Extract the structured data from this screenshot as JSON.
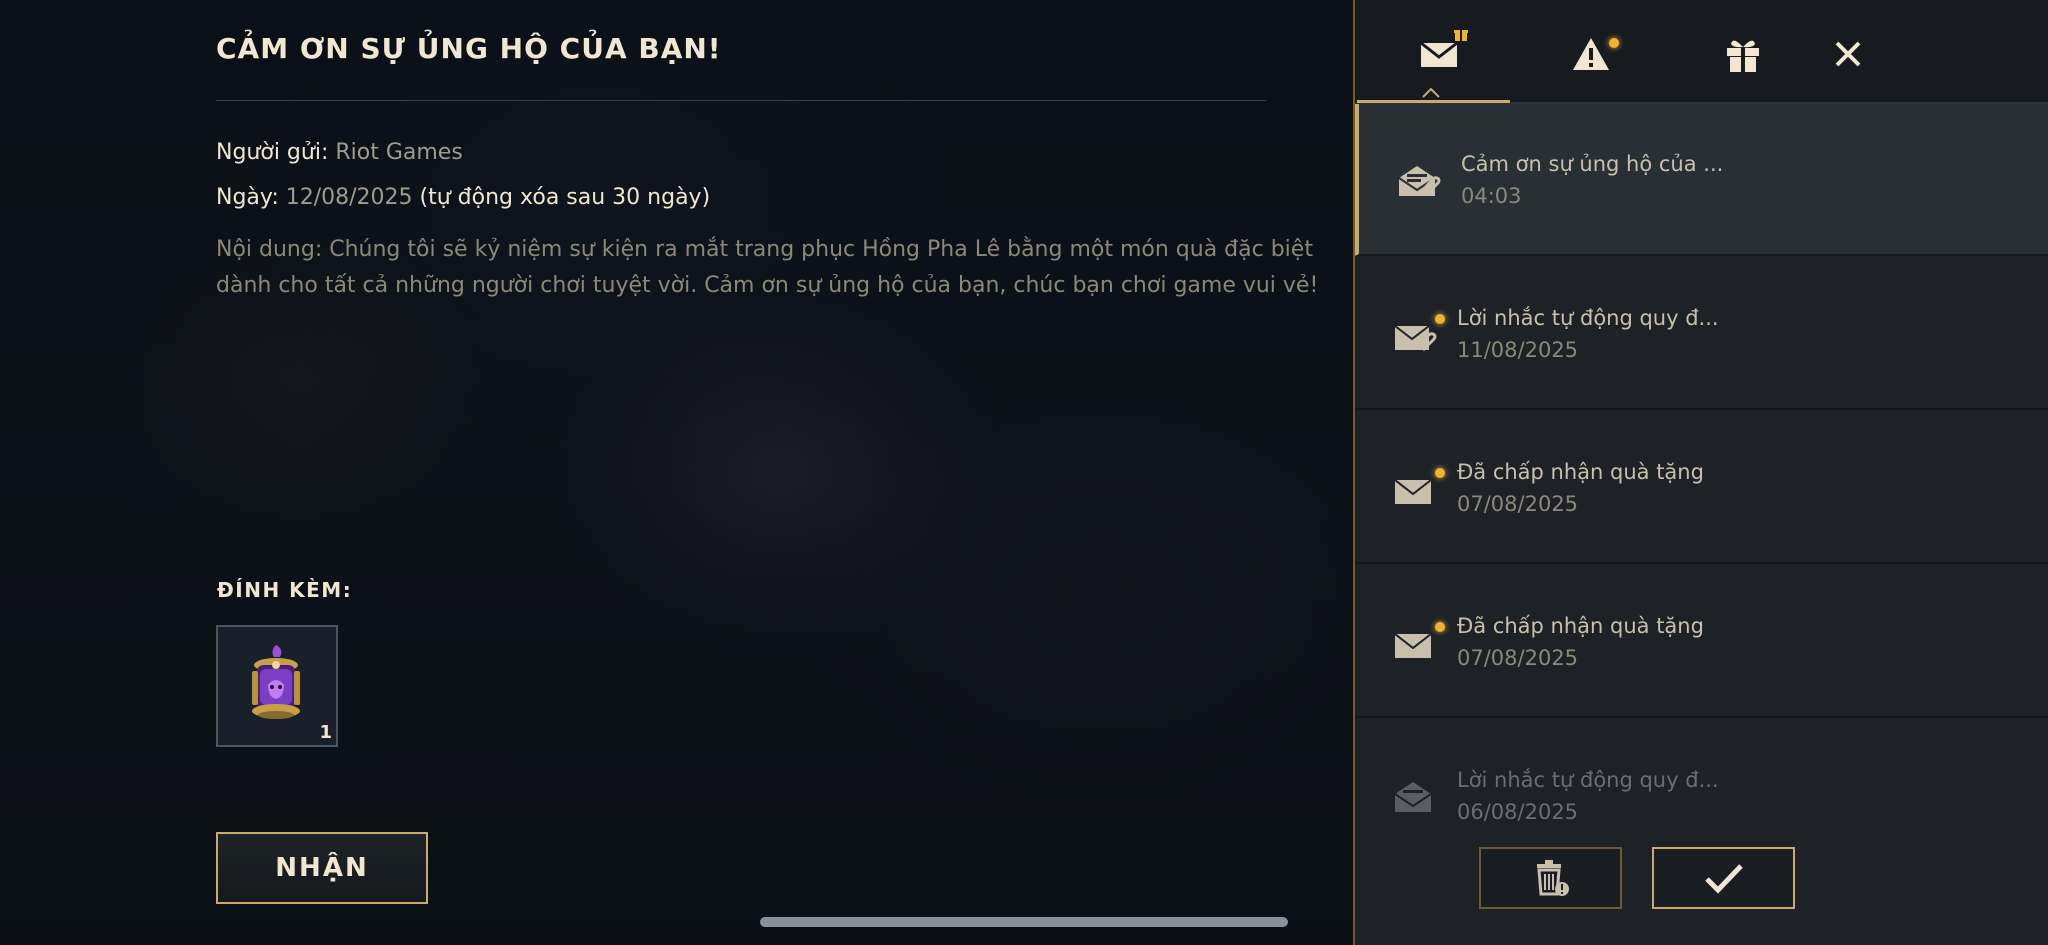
{
  "mail": {
    "title": "CẢM ƠN SỰ ỦNG HỘ CỦA BẠN!",
    "sender_label": "Người gửi: ",
    "sender": "Riot Games",
    "date_label": "Ngày: ",
    "date": "12/08/2025",
    "auto_delete": " (tự động xóa sau 30 ngày)",
    "content": "Nội dung: Chúng tôi sẽ kỷ niệm sự kiện ra mắt trang phục Hồng Pha Lê bằng một món quà đặc biệt dành cho tất cả những người chơi tuyệt vời. Cảm ơn sự ủng hộ của bạn, chúc bạn chơi game vui vẻ!",
    "attachments_label": "ĐÍNH KÈM:",
    "attachment_qty": "1",
    "claim_label": "NHẬN"
  },
  "tabs": [
    {
      "icon": "mail-icon",
      "badge": true
    },
    {
      "icon": "alert-icon",
      "badge": true
    },
    {
      "icon": "gift-icon",
      "badge": false
    },
    {
      "icon": "close-icon",
      "badge": false
    }
  ],
  "inbox": [
    {
      "title": "Cảm ơn sự ủng hộ của ...",
      "time": "04:03",
      "icon": "open-mail-attachment-icon",
      "unread": false,
      "selected": true
    },
    {
      "title": "Lời nhắc tự động quy đ...",
      "time": "11/08/2025",
      "icon": "mail-attachment-icon",
      "unread": true,
      "selected": false
    },
    {
      "title": "Đã chấp nhận quà tặng",
      "time": "07/08/2025",
      "icon": "mail-icon",
      "unread": true,
      "selected": false
    },
    {
      "title": "Đã chấp nhận quà tặng",
      "time": "07/08/2025",
      "icon": "mail-icon",
      "unread": true,
      "selected": false
    },
    {
      "title": "Lời nhắc tự động quy đ...",
      "time": "06/08/2025",
      "icon": "open-mail-icon",
      "unread": false,
      "selected": false
    }
  ],
  "colors": {
    "gold": "#c8aa6e",
    "badge": "#f0b232",
    "text": "#f0e6d2"
  }
}
